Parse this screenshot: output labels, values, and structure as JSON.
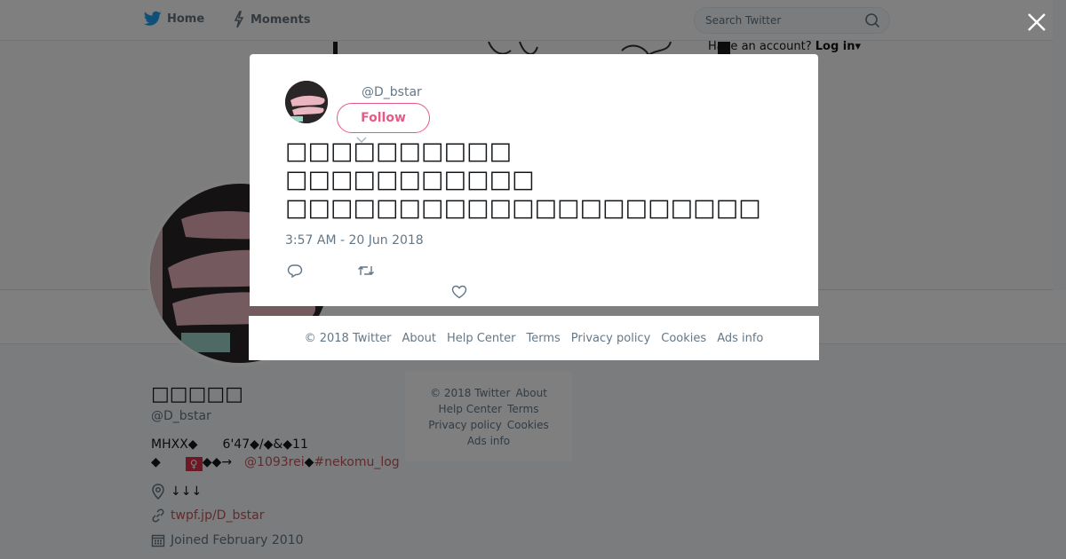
{
  "nav": {
    "home_label": "Home",
    "moments_label": "Moments",
    "search_placeholder": "Search Twitter",
    "login_prompt": "Have an account?",
    "login_label": "Log in"
  },
  "profile": {
    "name": "□□□□□",
    "handle": "@D_bstar",
    "bio_line1_text": "MHXX◆  6'47◆/◆&◆11",
    "bio_line2_prefix": "◆  ",
    "bio_emoji": "♀",
    "bio_line2_mid": "◆◆→ ",
    "bio_mention": "@1093rei",
    "bio_line2_sep": "◆",
    "bio_hashtag": "#nekomu_log",
    "location": "↓↓↓",
    "url": "twpf.jp/D_bstar",
    "joined": "Joined February 2010"
  },
  "side_footer": {
    "copyright": "© 2018 Twitter",
    "about": "About",
    "help": "Help Center",
    "terms": "Terms",
    "privacy": "Privacy policy",
    "cookies": "Cookies",
    "ads": "Ads info"
  },
  "tweet": {
    "handle": "@D_bstar",
    "follow_label": "Follow",
    "text": "□□□□□□□□□□\n□□□□□□□□□□□\n□□□□□□□□□□□□□□□□□□□□□",
    "timestamp": "3:57 AM - 20 Jun 2018"
  },
  "modal_footer": {
    "copyright": "© 2018 Twitter",
    "about": "About",
    "help": "Help Center",
    "terms": "Terms",
    "privacy": "Privacy policy",
    "cookies": "Cookies",
    "ads": "Ads info"
  },
  "colors": {
    "twitter_blue": "#1da1f2",
    "link_color": "#c2575e",
    "follow_pink": "#e0245e",
    "scrim": "rgba(0,0,0,0.5)"
  },
  "icons": [
    "twitter-bird-icon",
    "lightning-icon",
    "search-icon",
    "close-icon",
    "caret-down-icon",
    "reply-icon",
    "retweet-icon",
    "heart-icon",
    "location-pin-icon",
    "link-icon",
    "calendar-icon"
  ]
}
